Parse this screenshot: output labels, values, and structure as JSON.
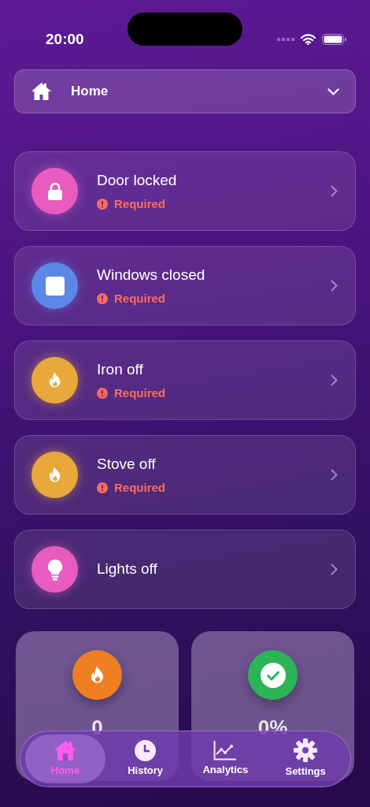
{
  "status_bar": {
    "time": "20:00"
  },
  "home_picker": {
    "label": "Home"
  },
  "checklist": [
    {
      "kind": "lock",
      "color": "#e85cc0",
      "title": "Door locked",
      "status": "Required"
    },
    {
      "kind": "window",
      "color": "#5b88e6",
      "title": "Windows closed",
      "status": "Required"
    },
    {
      "kind": "flame",
      "color": "#e8a83a",
      "title": "Iron off",
      "status": "Required"
    },
    {
      "kind": "flame",
      "color": "#e8a83a",
      "title": "Stove off",
      "status": "Required"
    },
    {
      "kind": "bulb",
      "color": "#e85cc0",
      "title": "Lights off"
    }
  ],
  "stats": [
    {
      "kind": "flame",
      "color": "#ee7f22",
      "value": "0"
    },
    {
      "kind": "check",
      "color": "#2cb556",
      "value": "0%"
    }
  ],
  "tab_bar": [
    {
      "kind": "home",
      "label": "Home",
      "selected": true
    },
    {
      "kind": "history",
      "label": "History",
      "selected": false
    },
    {
      "kind": "analytics",
      "label": "Analytics",
      "selected": false
    },
    {
      "kind": "settings",
      "label": "Settings",
      "selected": false
    }
  ]
}
